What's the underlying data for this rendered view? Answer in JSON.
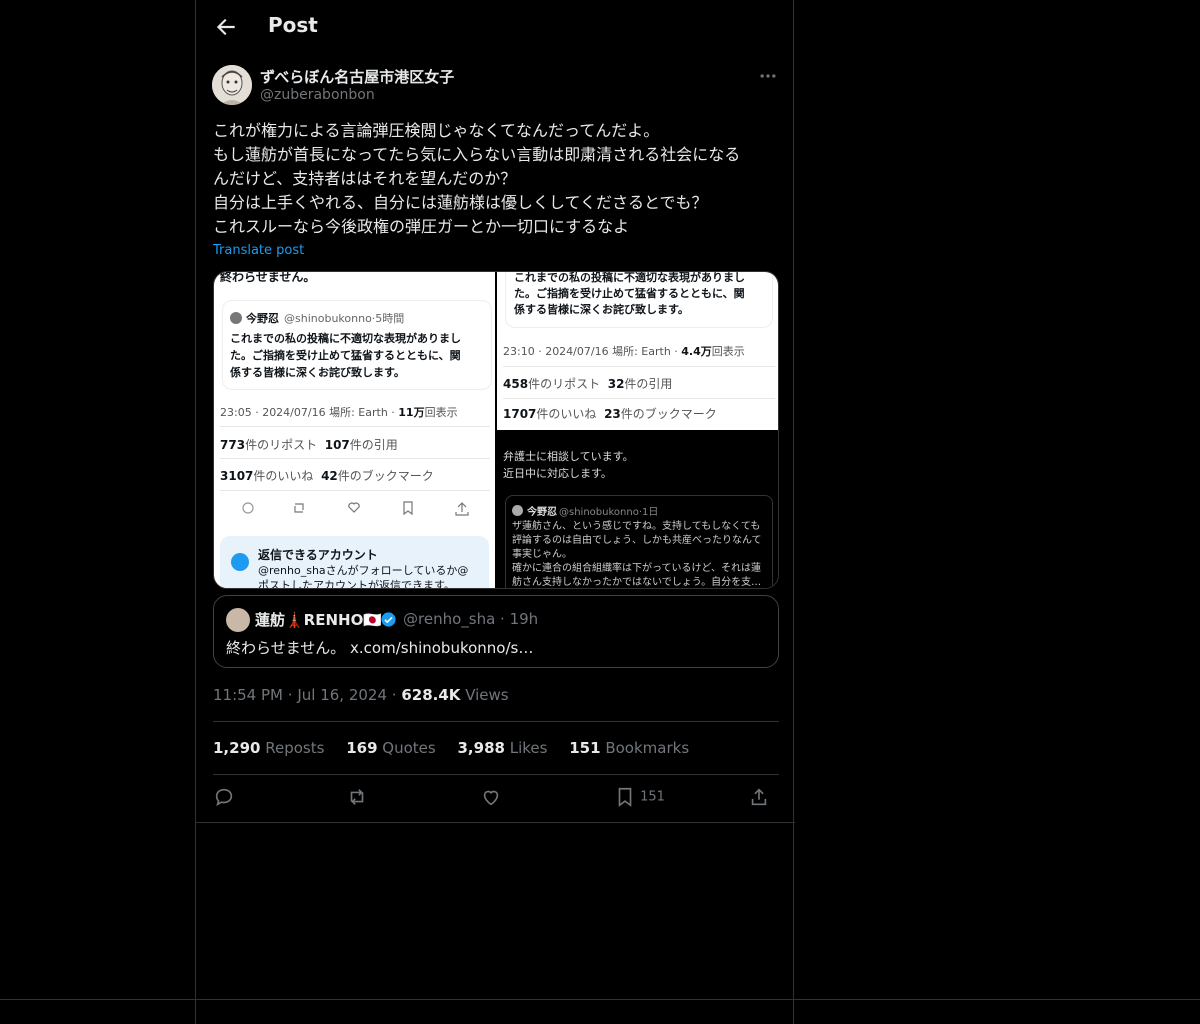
{
  "header": {
    "title": "Post"
  },
  "author": {
    "name": "ずべらぼん名古屋市港区女子",
    "handle": "@zuberabonbon"
  },
  "tweet": {
    "lines": [
      "これが権力による言論弾圧検閲じゃなくてなんだってんだよ。",
      "もし蓮舫が首長になってたら気に入らない言動は即粛清される社会になる",
      "んだけど、支持者ははそれを望んだのか？",
      "自分は上手くやれる、自分には蓮舫様は優しくしてくださるとでも？",
      "これスルーなら今後政権の弾圧ガーとか一切口にするなよ"
    ],
    "translate": "Translate post"
  },
  "screenshot_left": {
    "top_text": "終わらせません。",
    "quote_name": "今野忍",
    "quote_handle": "@shinobukonno·5時間",
    "quote_lines": [
      "これまでの私の投稿に不適切な表現がありまし",
      "た。ご指摘を受け止めて猛省するとともに、関",
      "係する皆様に深くお詫び致します。"
    ],
    "time_line_pre": "23:05 · 2024/07/16 場所: Earth · ",
    "views_num": "11万",
    "views_suffix": "回表示",
    "reposts_num": "773",
    "reposts_label": "件のリポスト",
    "quotes_num": "107",
    "quotes_label": "件の引用",
    "likes_num": "3107",
    "likes_label": "件のいいね",
    "bookmarks_num": "42",
    "bookmarks_label": "件のブックマーク",
    "reply_title": "返信できるアカウント",
    "reply_line1": "@renho_shaさんがフォローしているか@",
    "reply_line2": "ポストしたアカウントが返信できます。"
  },
  "screenshot_right": {
    "quote_lines": [
      "これまでの私の投稿に不適切な表現がありまし",
      "た。ご指摘を受け止めて猛省するとともに、関",
      "係する皆様に深くお詫び致します。"
    ],
    "time_line_pre": "23:10 · 2024/07/16 場所: Earth · ",
    "views_num": "4.4万",
    "views_suffix": "回表示",
    "reposts_num": "458",
    "reposts_label": "件のリポスト",
    "quotes_num": "32",
    "quotes_label": "件の引用",
    "likes_num": "1707",
    "likes_label": "件のいいね",
    "bookmarks_num": "23",
    "bookmarks_label": "件のブックマーク",
    "dark_line1": "弁護士に相談しています。",
    "dark_line2": "近日中に対応します。",
    "inner_name": "今野忍",
    "inner_handle": "@shinobukonno·1日",
    "inner_lines": [
      "ザ蓮舫さん、という感じですね。支持してもしなくても",
      "評論するのは自由でしょう、しかも共産べったりなんて",
      "事実じゃん。",
      "確かに連合の組合組織率は下がっているけど、それは蓮",
      "舫さん支持しなかったかではないでしょう。自分を支…"
    ]
  },
  "quoted_post": {
    "name": "蓮舫🗼RENHO🇯🇵",
    "handle": "@renho_sha",
    "time": "19h",
    "text": "終わらせません。 x.com/shinobukonno/s…"
  },
  "meta": {
    "time": "11:54 PM",
    "date": "Jul 16, 2024",
    "views_count": "628.4K",
    "views_label": "Views",
    "sep": "·"
  },
  "stats": {
    "reposts_count": "1,290",
    "reposts_label": "Reposts",
    "quotes_count": "169",
    "quotes_label": "Quotes",
    "likes_count": "3,988",
    "likes_label": "Likes",
    "bookmarks_count": "151",
    "bookmarks_label": "Bookmarks"
  },
  "actions": {
    "bookmark_count": "151"
  },
  "colors": {
    "accent": "#1d9bf0",
    "muted": "#71767b",
    "text": "#e7e9ea",
    "border": "#2f3336"
  },
  "icons": [
    "back-arrow-icon",
    "more-icon",
    "reply-icon",
    "repost-icon",
    "like-icon",
    "bookmark-icon",
    "share-icon",
    "verified-icon"
  ]
}
